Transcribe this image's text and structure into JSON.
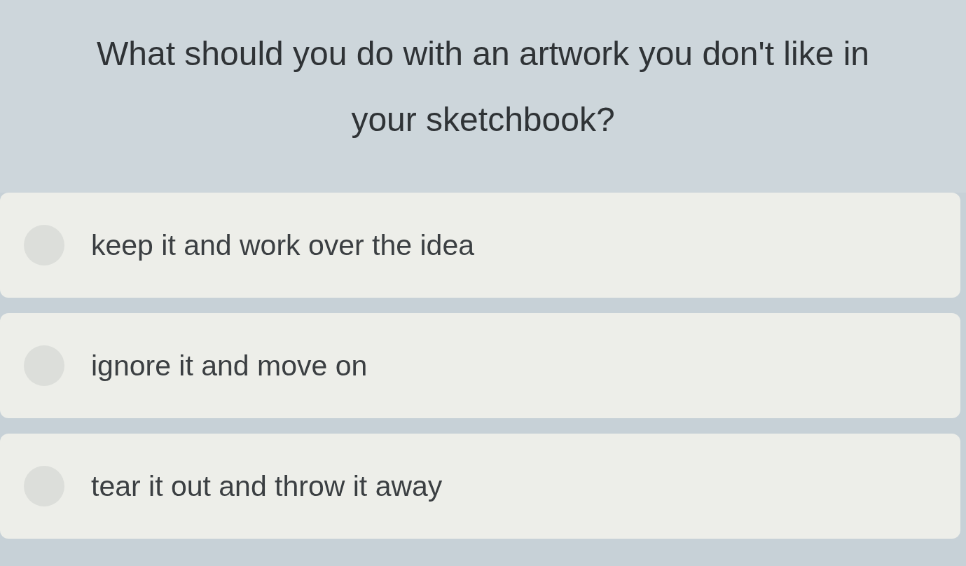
{
  "question": "What should you do with an artwork you don't like in your sketchbook?",
  "options": [
    {
      "label": "keep it and work over the idea",
      "selected": false
    },
    {
      "label": "ignore it and move on",
      "selected": false
    },
    {
      "label": "tear it out and throw it away",
      "selected": false
    }
  ]
}
